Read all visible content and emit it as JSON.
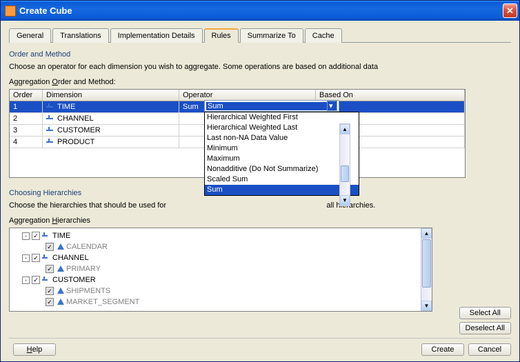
{
  "titlebar": {
    "title": "Create Cube"
  },
  "tabs": [
    "General",
    "Translations",
    "Implementation Details",
    "Rules",
    "Summarize To",
    "Cache"
  ],
  "activeTab": 3,
  "section1": {
    "title": "Order and Method",
    "desc": "Choose an operator for each dimension you wish to aggregate. Some operations are based on additional data",
    "tableLabel_pre": "Aggregation ",
    "tableLabel_u": "O",
    "tableLabel_post": "rder and Method:",
    "headers": {
      "order": "Order",
      "dim": "Dimension",
      "op": "Operator",
      "based": "Based On"
    },
    "rows": [
      {
        "order": "1",
        "dim": "TIME",
        "op": "Sum",
        "based": ""
      },
      {
        "order": "2",
        "dim": "CHANNEL",
        "op": "",
        "based": ""
      },
      {
        "order": "3",
        "dim": "CUSTOMER",
        "op": "",
        "based": ""
      },
      {
        "order": "4",
        "dim": "PRODUCT",
        "op": "",
        "based": ""
      }
    ]
  },
  "combo": {
    "selected": "Sum",
    "options": [
      "Hierarchical Weighted First",
      "Hierarchical Weighted Last",
      "Last non-NA Data Value",
      "Minimum",
      "Maximum",
      "Nonadditive (Do Not Summarize)",
      "Scaled Sum",
      "Sum"
    ],
    "highlighted": 7
  },
  "section2": {
    "title": "Choosing Hierarchies",
    "desc_pre": "Choose the hierarchies that should be used for ",
    "desc_post": " all hierarchies.",
    "treeLabel_pre": "Aggregation ",
    "treeLabel_u": "H",
    "treeLabel_post": "ierarchies"
  },
  "tree": [
    {
      "level": 1,
      "exp": "-",
      "chk": "✓",
      "icon": "dim",
      "label": "TIME",
      "grey": false
    },
    {
      "level": 2,
      "exp": "",
      "chk": "g",
      "icon": "lvl",
      "label": "CALENDAR",
      "grey": true
    },
    {
      "level": 1,
      "exp": "-",
      "chk": "✓",
      "icon": "dim",
      "label": "CHANNEL",
      "grey": false
    },
    {
      "level": 2,
      "exp": "",
      "chk": "g",
      "icon": "lvl",
      "label": "PRIMARY",
      "grey": true
    },
    {
      "level": 1,
      "exp": "-",
      "chk": "✓",
      "icon": "dim",
      "label": "CUSTOMER",
      "grey": false
    },
    {
      "level": 2,
      "exp": "",
      "chk": "g",
      "icon": "lvl",
      "label": "SHIPMENTS",
      "grey": true
    },
    {
      "level": 2,
      "exp": "",
      "chk": "g",
      "icon": "lvl",
      "label": "MARKET_SEGMENT",
      "grey": true
    }
  ],
  "buttons": {
    "selectAll_u": "S",
    "selectAll_post": "elect All",
    "deselectAll_u": "D",
    "deselectAll_post": "eselect All",
    "help_u": "H",
    "help_post": "elp",
    "create_u": "C",
    "create_post": "reate",
    "cancel": "Cancel"
  }
}
